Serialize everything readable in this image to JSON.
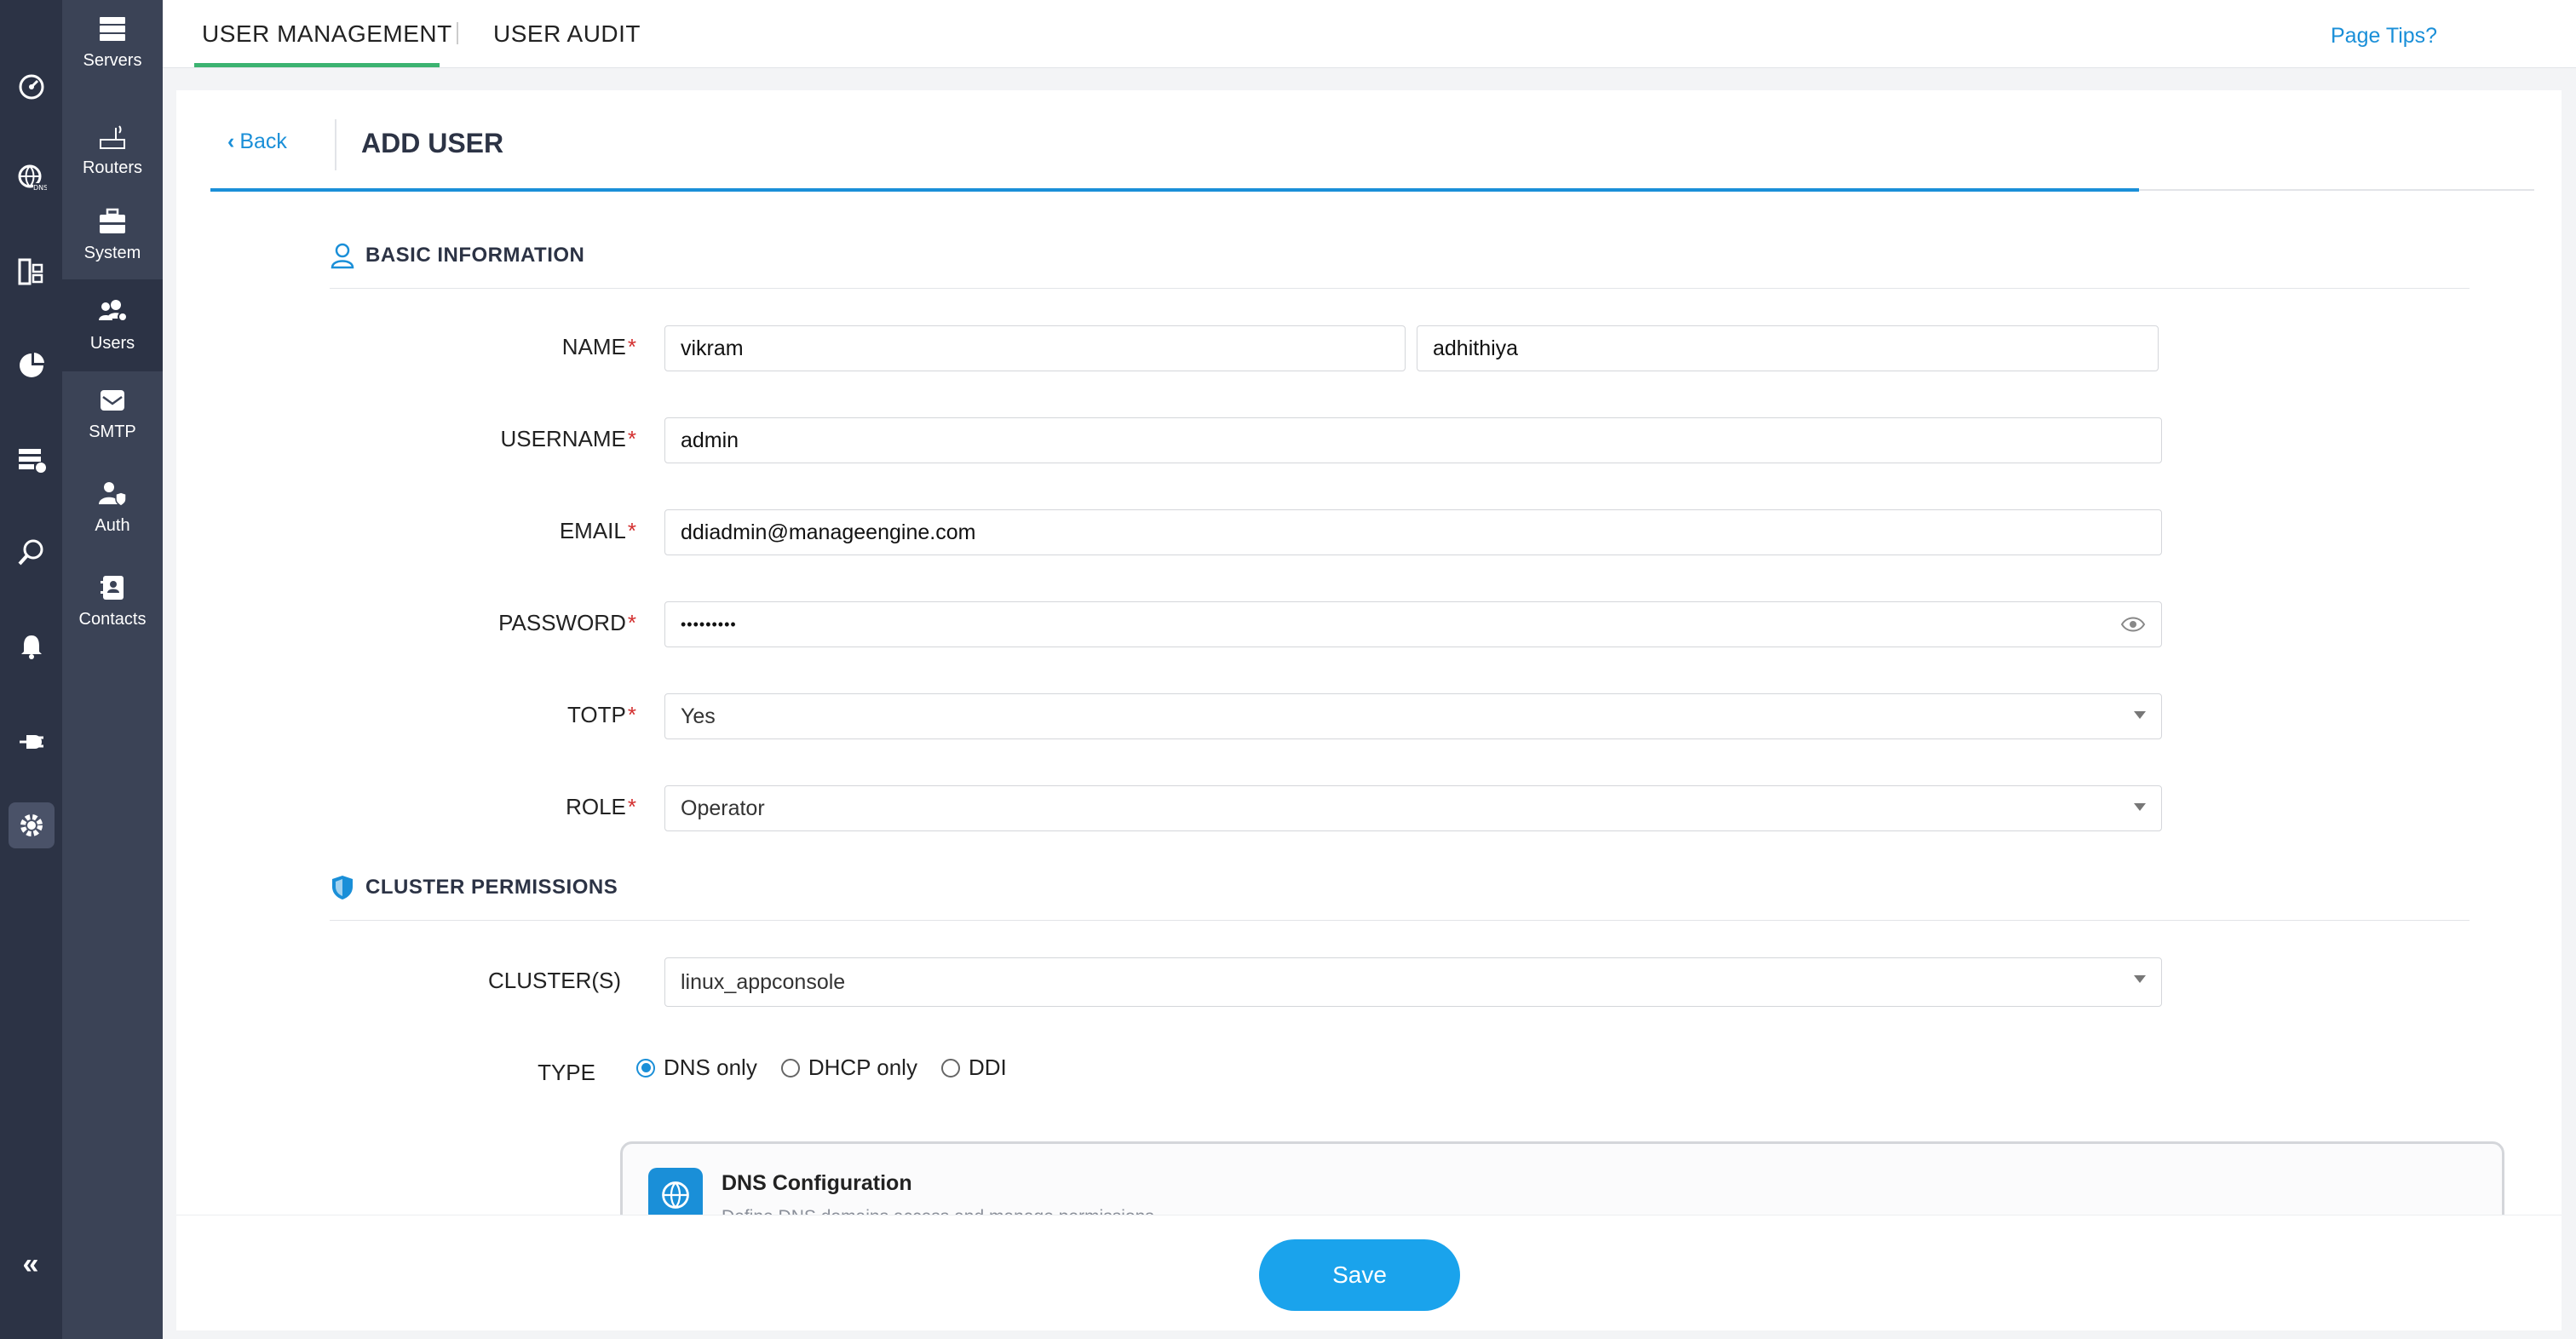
{
  "rail": {
    "icons": [
      "dashboard-icon",
      "dns-globe-icon",
      "ipam-icon",
      "reports-icon",
      "dhcp-icon",
      "audit-search-icon",
      "alarm-bell-icon",
      "integration-plug-icon",
      "settings-gear-icon"
    ],
    "active_icon": "settings-gear-icon",
    "collapse_glyph": "«"
  },
  "subnav": {
    "items": [
      {
        "label": "Servers",
        "icon": "servers-icon"
      },
      {
        "label": "Routers",
        "icon": "router-icon"
      },
      {
        "label": "System",
        "icon": "toolbox-icon"
      },
      {
        "label": "Users",
        "icon": "users-icon",
        "active": true
      },
      {
        "label": "SMTP",
        "icon": "mail-icon"
      },
      {
        "label": "Auth",
        "icon": "user-shield-icon"
      },
      {
        "label": "Contacts",
        "icon": "contacts-icon"
      }
    ]
  },
  "topbar": {
    "tabs": [
      {
        "label": "USER MANAGEMENT",
        "active": true
      },
      {
        "label": "USER AUDIT",
        "active": false
      }
    ],
    "page_tips": "Page Tips?"
  },
  "header": {
    "back_label": "Back",
    "title": "ADD USER"
  },
  "basic_info": {
    "title": "BASIC INFORMATION",
    "name_label": "NAME",
    "first_name": "vikram",
    "last_name": "adhithiya",
    "username_label": "USERNAME",
    "username": "admin",
    "email_label": "EMAIL",
    "email": "ddiadmin@manageengine.com",
    "password_label": "PASSWORD",
    "password_mask": "•••••••••",
    "totp_label": "TOTP",
    "totp_value": "Yes",
    "role_label": "ROLE",
    "role_value": "Operator",
    "required_mark": "*"
  },
  "cluster_permissions": {
    "title": "CLUSTER PERMISSIONS",
    "clusters_label": "CLUSTER(S)",
    "clusters_value": "linux_appconsole",
    "type_label": "TYPE",
    "type_options": [
      {
        "label": "DNS only",
        "selected": true
      },
      {
        "label": "DHCP only",
        "selected": false
      },
      {
        "label": "DDI",
        "selected": false
      }
    ]
  },
  "dns_config": {
    "title": "DNS Configuration",
    "subtitle": "Define DNS domains access and manage permissions"
  },
  "footer": {
    "save_label": "Save"
  },
  "colors": {
    "accent": "#1a8fd8",
    "tab_underline": "#3cb371",
    "rail_bg": "#2c3345",
    "subnav_bg": "#3b4356",
    "required": "#d32f2f",
    "save_button": "#1aa3ec"
  }
}
